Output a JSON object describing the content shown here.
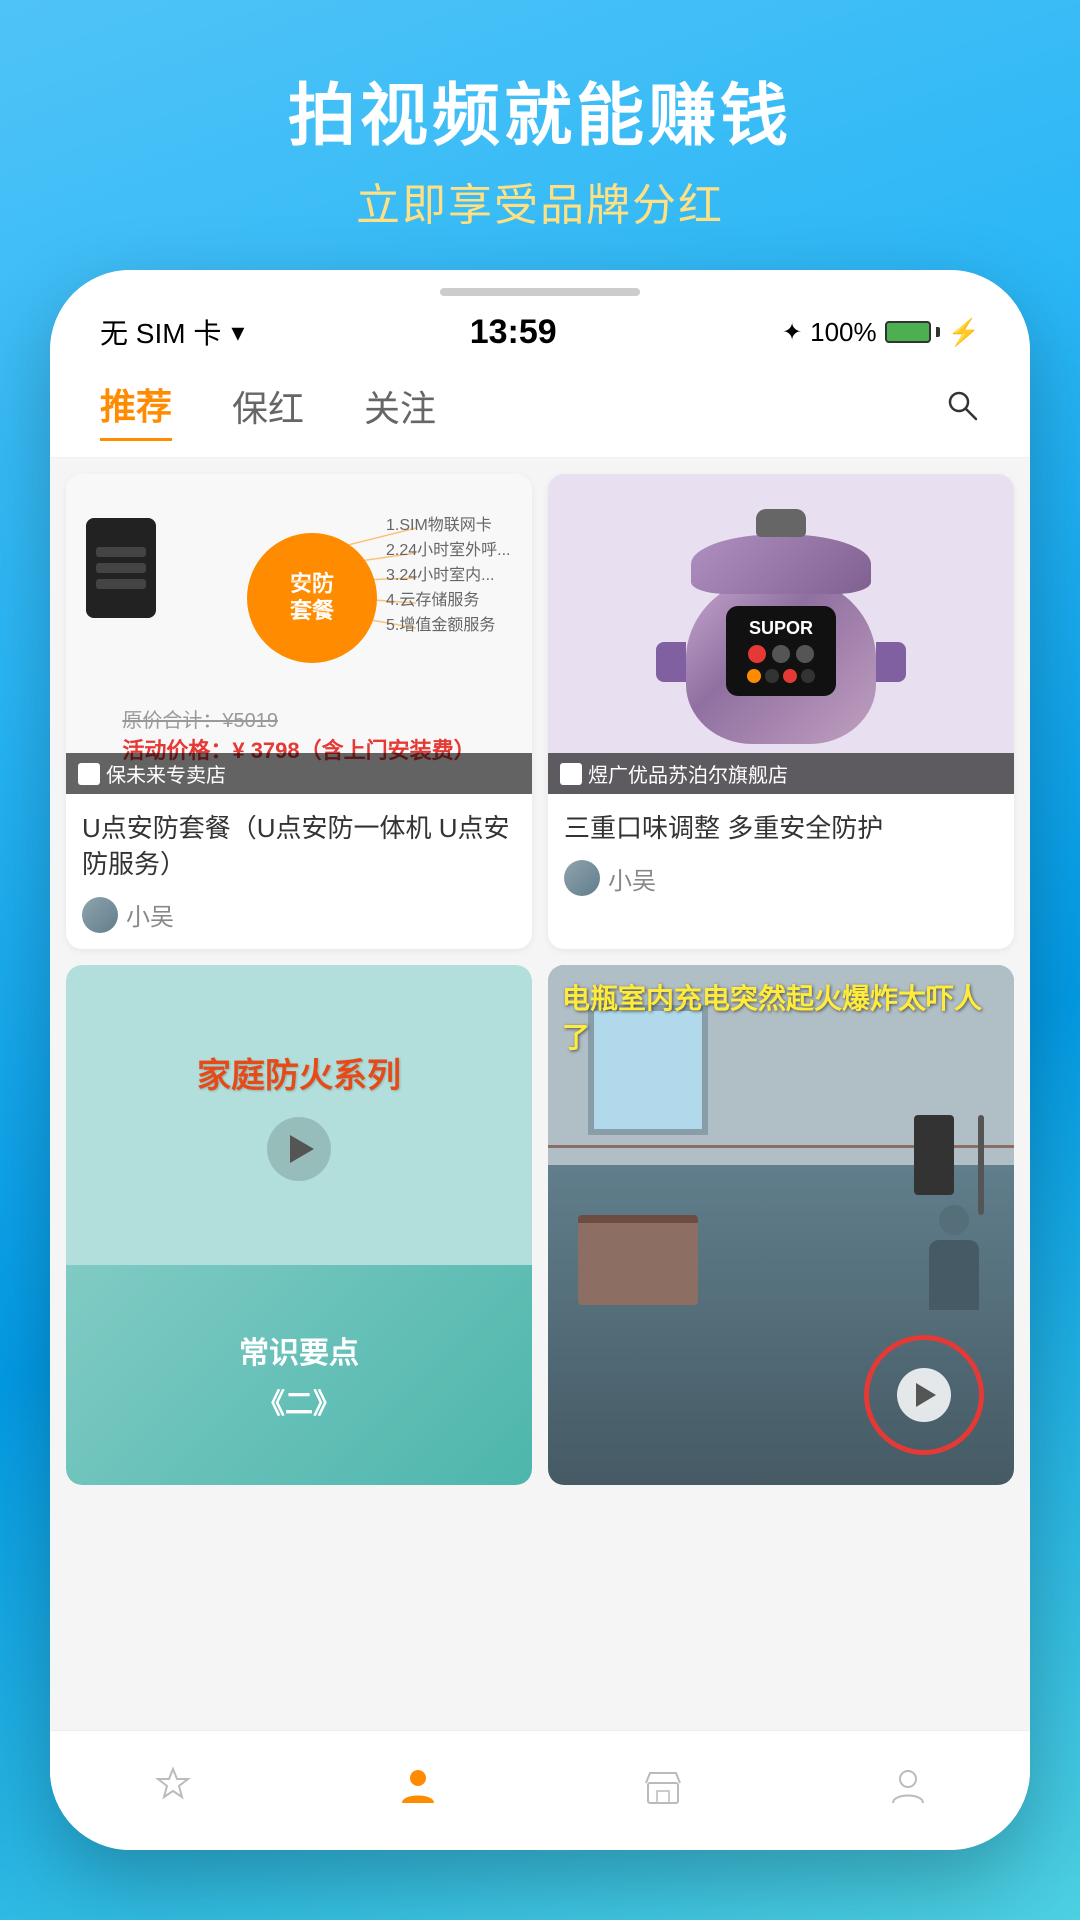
{
  "bg": {
    "title": "拍视频就能赚钱",
    "subtitle": "立即享受品牌分红"
  },
  "statusBar": {
    "carrier": "无 SIM 卡",
    "time": "13:59",
    "battery": "100%"
  },
  "nav": {
    "tabs": [
      {
        "label": "推荐",
        "active": true
      },
      {
        "label": "保红",
        "active": false
      },
      {
        "label": "关注",
        "active": false
      }
    ],
    "searchIcon": "search"
  },
  "products": [
    {
      "id": "security",
      "storeName": "保未来专卖店",
      "originalPrice": "原价合计：¥5019",
      "salePrice": "活动价格：¥ 3798（含上门安装费）",
      "title": "U点安防套餐（U点安防一体机 U点安防服务）",
      "author": "小吴",
      "circleText": "安防套餐"
    },
    {
      "id": "cooker",
      "storeName": "煜广优品苏泊尔旗舰店",
      "brand": "SUPOR",
      "title": "三重口味调整 多重安全防护",
      "author": "小吴"
    }
  ],
  "secondRow": [
    {
      "id": "fire",
      "bgColor": "#b2dfdb",
      "title": "家庭防火系列",
      "hasVideo": true
    },
    {
      "id": "explosion",
      "overlayText": "电瓶室内充电突然起火爆炸太吓人了",
      "hasVideo": true
    }
  ],
  "thirdRow": [
    {
      "id": "knowledge",
      "title": "常识要点",
      "subtitle": "《二》"
    }
  ],
  "bottomTabs": [
    {
      "label": "收藏",
      "icon": "☆",
      "active": false
    },
    {
      "label": "我的",
      "icon": "👤",
      "active": true
    },
    {
      "label": "商城",
      "icon": "🏪",
      "active": false
    },
    {
      "label": "我",
      "icon": "👤",
      "active": false
    }
  ]
}
